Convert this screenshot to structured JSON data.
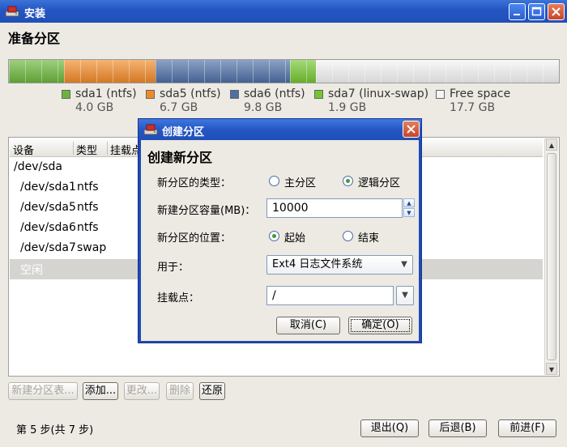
{
  "window": {
    "title": "安装",
    "page_title": "准备分区"
  },
  "disk": {
    "segments": [
      {
        "label": "sda1 (ntfs)",
        "size": "4.0 GB",
        "color": "#6ab63c",
        "share": 4.0
      },
      {
        "label": "sda5 (ntfs)",
        "size": "6.7 GB",
        "color": "#f08a28",
        "share": 6.7
      },
      {
        "label": "sda6 (ntfs)",
        "size": "9.8 GB",
        "color": "#4e6fa6",
        "share": 9.8
      },
      {
        "label": "sda7 (linux-swap)",
        "size": "1.9 GB",
        "color": "#74c630",
        "share": 1.9
      },
      {
        "label": "Free space",
        "size": "17.7 GB",
        "color": "#f4f4f4",
        "share": 17.7
      }
    ]
  },
  "table": {
    "headers": [
      "设备",
      "类型",
      "挂载点"
    ],
    "rows": [
      {
        "device": "/dev/sda",
        "type": ""
      },
      {
        "device": "/dev/sda1",
        "type": "ntfs"
      },
      {
        "device": "/dev/sda5",
        "type": "ntfs"
      },
      {
        "device": "/dev/sda6",
        "type": "ntfs"
      },
      {
        "device": "/dev/sda7",
        "type": "swap"
      },
      {
        "device": "空闲",
        "type": ""
      }
    ]
  },
  "actions": {
    "new_table": "新建分区表...",
    "add": "添加...",
    "change": "更改...",
    "delete": "删除",
    "revert": "还原"
  },
  "footer": {
    "step": "第 5 步(共 7 步)",
    "quit": "退出(Q)",
    "back": "后退(B)",
    "forward": "前进(F)"
  },
  "dialog": {
    "title": "创建分区",
    "heading": "创建新分区",
    "type_label": "新分区的类型：",
    "type_primary": "主分区",
    "type_logical": "逻辑分区",
    "size_label": "新建分区容量(MB)：",
    "size_value": "10000",
    "location_label": "新分区的位置：",
    "location_begin": "起始",
    "location_end": "结束",
    "use_label": "用于：",
    "use_value": "Ext4 日志文件系统",
    "mount_label": "挂载点：",
    "mount_value": "/",
    "cancel": "取消(C)",
    "ok": "确定(O)"
  }
}
